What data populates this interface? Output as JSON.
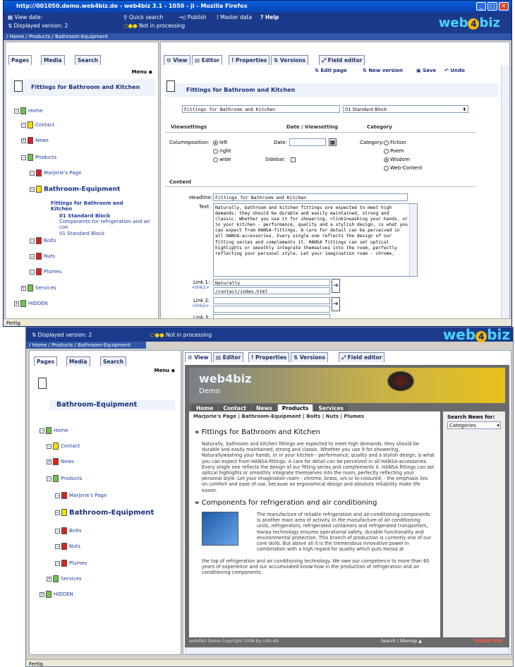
{
  "win1": {
    "title": "http://001050.demo.web4biz.de - web4biz 3.1 - 1050 - jl - Mozilla Firefox",
    "view_date": "View date:",
    "displayed_version": "Displayed version: 2",
    "processing": "Not in processing",
    "quick_search": "Quick search",
    "publish": "Publish",
    "master_data": "Master data",
    "help": "? Help",
    "breadcrumb": "/ Home / Products / Bathroom-Equipment",
    "logo": "web",
    "logo2": "biz",
    "left_tabs": [
      "Pages",
      "Media",
      "Search"
    ],
    "menu": "Menu ◆",
    "page_heading": "Fittings for Bathroom and Kitchen",
    "tree": [
      "Home",
      "Contact",
      "News",
      "Products",
      "Marjorie's Page",
      "Bathroom-Equipment",
      "Fittings for Bathroom and Kitchen",
      "01 Standard Block",
      "Components for refrigeration and air con",
      "01 Standard Block",
      "Bolts",
      "Nuts",
      "Plumes",
      "Services",
      "HIDDEN"
    ],
    "right_tabs": [
      "View",
      "Editor",
      "Properties",
      "Versions",
      "Field editor"
    ],
    "actions": [
      "Edit page",
      "New version",
      "Save",
      "Undo"
    ],
    "editor_title": "Fittings for Bathroom and Kitchen",
    "title_field": "Fittings for Bathroom and Kitchen",
    "block_select": "01 Standard Block",
    "col_viewsettings": "Viewsettings",
    "col_date": "Date / Viewsetting",
    "col_category": "Category",
    "columnposition": "Columnposition:",
    "radio_left": "left",
    "radio_right": "right",
    "radio_wide": "wide",
    "date_label": "Date:",
    "sidebar_label": "Sidebar:",
    "category_label": "Category:",
    "cat_options": [
      "Fiction",
      "Poem",
      "Wisdom",
      "Web-Content"
    ],
    "content": "Content",
    "headline_label": "Headline:",
    "headline_value": "Fittings for Bathroom and Kitchen",
    "text_label": "Text:",
    "text_value": "Naturally, bathroom and kitchen fittings are expected to meet high demands: they should be durable and easily maintained, strong and classic. Whether you use it for showering, <link1>washing your hands, or in your kitchen - performance, quality and a stylish design, is what you can expect from HANSA-fittings. A care for detail can be perceived in all HANSA-accessories. Every single one reflects the design of our fitting series and complements it. HANSA fittings can set optical highlights or smoothly integrate themselves into the room, perfectly reflecting your personal style. Let your imagination roam - chrome,",
    "link1_label": "Link 1:",
    "link1_tag": "<link1>",
    "link1_text": "Naturally",
    "link1_url": "/contact/index.html",
    "link2_label": "Link 2:",
    "link2_tag": "<link2>",
    "link3_label": "Link 3:",
    "link3_tag": "<link3>",
    "status": "Fertig"
  },
  "win2": {
    "displayed_version": "Displayed version: 2",
    "processing": "Not in processing",
    "breadcrumb": "/ Home / Products / Bathroom-Equipment",
    "left_tabs": [
      "Pages",
      "Media",
      "Search"
    ],
    "menu": "Menu ◆",
    "page_heading": "Bathroom-Equipment",
    "tree": [
      "Home",
      "Contact",
      "News",
      "Products",
      "Marjorie's Page",
      "Bathroom-Equipment",
      "Bolts",
      "Nuts",
      "Plumes",
      "Services",
      "HIDDEN"
    ],
    "right_tabs": [
      "View",
      "Editor",
      "Properties",
      "Versions",
      "Field editor"
    ],
    "site_logo": "web4biz",
    "site_demo": "Demo",
    "site_nav": [
      "Home",
      "Contact",
      "News",
      "Products",
      "Services"
    ],
    "site_subnav": "Marjorie's Page | Bathroom-Equipment | Bolts | Nuts | Plumes",
    "search_news": "Search News for:",
    "categories": "Categories",
    "h1": "Fittings for Bathroom and Kitchen",
    "p1": "Naturally, bathroom and kitchen fittings are expected to meet high demands: they should be durable and easily maintained, strong and classic. Whether you use it for showering, Naturallywashing your hands, or in your kitchen - performance, quality and a stylish design, is what you can expect from HANSA-fittings. A care for detail can be perceived in all HANSA-accessories. Every single one reflects the design of our fitting series and complements it. HANSA fittings can set optical highlights or smoothly integrate themselves into the room, perfectly reflecting your personal style. Let your imagination roam - chrome, brass, uni or bi-coloured, - the emphasis lies on comfort and ease of use, because an ergonomical design and absolute reliability make life easier.",
    "h2": "Components for refrigeration and air conditioning",
    "p2a": "The manufacture of reliable refrigeration and air-conditioning components is another main area of activity. In the manufacture of air conditioning units, refrigerators, refrigerated containers and refrigerated transporters, Hansa technology ensures operational safety, durable functionality and environmental protection. This branch of production is currently one of our core skills. But above all it is the tremendous innovative power in combination with a high regard for quality which puts Hansa at",
    "p2b": "the top of refrigeration and air conditioning technology. We owe our competence to more than 60 years of experience and our accumulated know-how in the production of refrigeration and air conditioning components.",
    "footer_left": "web4biz Demo Copyright 2006 by ic4b AG",
    "footer_mid": "Search | Sitemap ▲",
    "footer_right": "REDAKTION",
    "status": "Fertig"
  }
}
